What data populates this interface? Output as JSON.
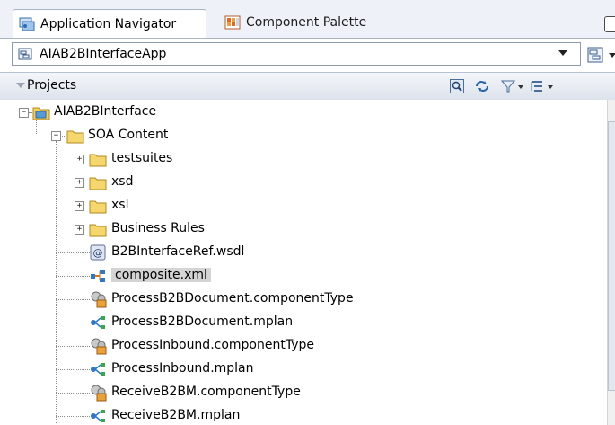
{
  "tabs": [
    {
      "label": "Application Navigator",
      "icon": "application-navigator-icon",
      "active": true
    },
    {
      "label": "Component Palette",
      "icon": "component-palette-icon",
      "active": false
    }
  ],
  "app_selector": {
    "value": "AIAB2BInterfaceApp",
    "icon": "application-icon"
  },
  "projects_panel": {
    "title": "Projects",
    "toolbar_icons": [
      "search-icon",
      "refresh-icon",
      "filter-icon",
      "tree-options-icon"
    ]
  },
  "tree": {
    "root": {
      "label": "AIAB2BInterface",
      "icon": "project-icon",
      "expanded": true
    },
    "soa_content": {
      "label": "SOA Content",
      "icon": "folder-icon",
      "expanded": true
    },
    "items": [
      {
        "label": "testsuites",
        "icon": "folder-icon",
        "expandable": true
      },
      {
        "label": "xsd",
        "icon": "folder-icon",
        "expandable": true
      },
      {
        "label": "xsl",
        "icon": "folder-icon",
        "expandable": true
      },
      {
        "label": "Business Rules",
        "icon": "folder-icon",
        "expandable": true
      },
      {
        "label": "B2BInterfaceRef.wsdl",
        "icon": "wsdl-icon",
        "expandable": false
      },
      {
        "label": "composite.xml",
        "icon": "composite-icon",
        "expandable": false,
        "selected": true
      },
      {
        "label": "ProcessB2BDocument.componentType",
        "icon": "component-type-icon",
        "expandable": false
      },
      {
        "label": "ProcessB2BDocument.mplan",
        "icon": "mplan-icon",
        "expandable": false
      },
      {
        "label": "ProcessInbound.componentType",
        "icon": "component-type-icon",
        "expandable": false
      },
      {
        "label": "ProcessInbound.mplan",
        "icon": "mplan-icon",
        "expandable": false
      },
      {
        "label": "ReceiveB2BM.componentType",
        "icon": "component-type-icon",
        "expandable": false
      },
      {
        "label": "ReceiveB2BM.mplan",
        "icon": "mplan-icon",
        "expandable": false
      }
    ]
  },
  "colors": {
    "tab_strip": "#eef2f8",
    "folder": "#f5d76e",
    "selection": "#d4d4d4"
  }
}
